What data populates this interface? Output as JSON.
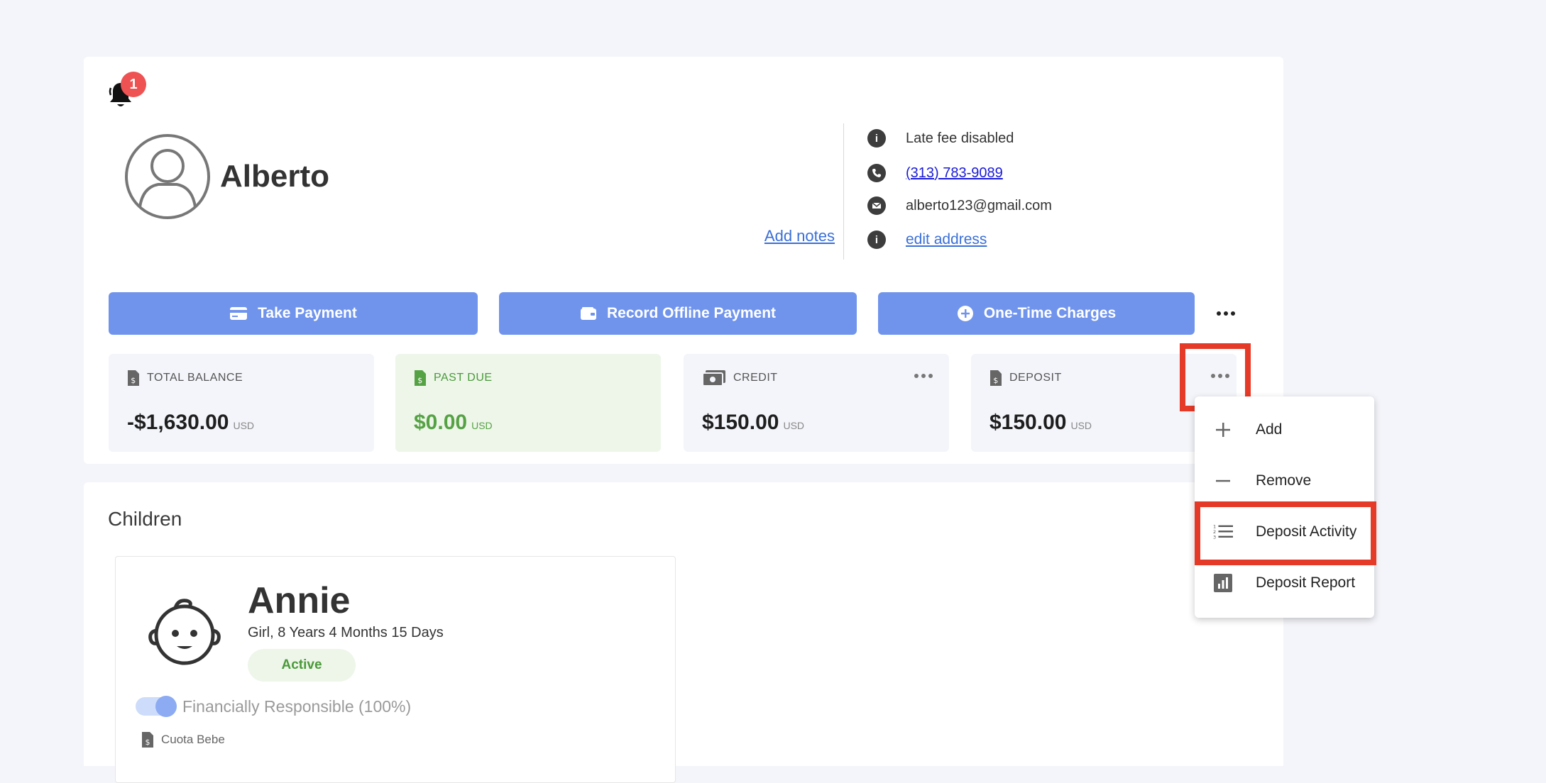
{
  "notifications": {
    "count": "1"
  },
  "parent": {
    "name": "Alberto",
    "add_notes_label": "Add notes",
    "late_fee_text": "Late fee disabled",
    "phone": "(313) 783-9089",
    "email": "alberto123@gmail.com",
    "address_link": "edit address"
  },
  "actions": {
    "take_payment": "Take Payment",
    "record_offline_payment": "Record Offline Payment",
    "one_time_charges": "One-Time Charges"
  },
  "balances": {
    "total_balance": {
      "label": "TOTAL BALANCE",
      "amount": "-$1,630.00",
      "currency": "USD"
    },
    "past_due": {
      "label": "PAST DUE",
      "amount": "$0.00",
      "currency": "USD"
    },
    "credit": {
      "label": "CREDIT",
      "amount": "$150.00",
      "currency": "USD"
    },
    "deposit": {
      "label": "DEPOSIT",
      "amount": "$150.00",
      "currency": "USD"
    }
  },
  "deposit_menu": {
    "items": [
      {
        "label": "Add",
        "icon": "plus-icon"
      },
      {
        "label": "Remove",
        "icon": "minus-icon"
      },
      {
        "label": "Deposit Activity",
        "icon": "numbered-list-icon"
      },
      {
        "label": "Deposit Report",
        "icon": "report-chart-icon"
      }
    ]
  },
  "children": {
    "title": "Children",
    "items": [
      {
        "name": "Annie",
        "details": "Girl, 8 Years 4 Months 15 Days",
        "status": "Active",
        "financially_responsible": "Financially Responsible (100%)",
        "plan": "Cuota Bebe"
      }
    ]
  },
  "colors": {
    "primary_button": "#7094ec",
    "highlight": "#e53a27",
    "badge": "#ee5253",
    "success": "#55a244"
  }
}
